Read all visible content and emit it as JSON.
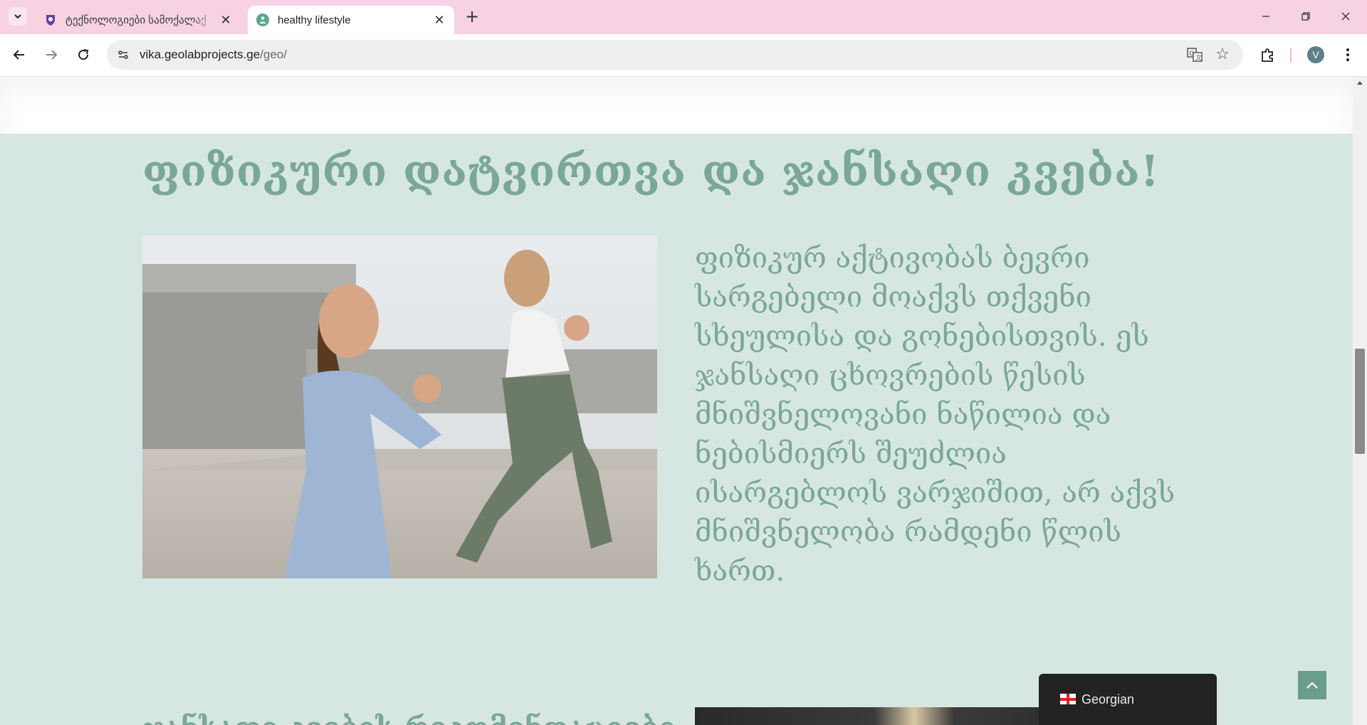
{
  "browser": {
    "tabs": [
      {
        "title": "ტექნოლოგიები სამოქალაქ",
        "active": false
      },
      {
        "title": "healthy lifestyle",
        "active": true
      }
    ],
    "url": {
      "host": "vika.geolabprojects.ge",
      "path": "/geo/"
    },
    "profile_initial": "V"
  },
  "page": {
    "section_title": "ფიზიკური დატვირთვა და ჯანსაღი კვება!",
    "body_lines": [
      "ფიზიკურ აქტივობას ბევრი",
      "სარგებელი მოაქვს თქვენი",
      "სხეულისა და გონებისთვის. ეს",
      "ჯანსაღი ცხოვრების წესის",
      "მნიშვნელოვანი ნაწილია და",
      "ნებისმიერს შეუძლია",
      "ისარგებლოს ვარჯიშით, არ აქვს",
      "მნიშვნელობა რამდენი წლის",
      "ხართ."
    ],
    "next_section_title_partial": "ჯანსაღი კვების რეკომენდაციები",
    "language_switcher": {
      "label": "Georgian",
      "flag": "georgia-flag"
    },
    "colors": {
      "accent": "#7aa797",
      "content_bg": "#d6e7e3",
      "tab_strip": "#f6d2e2",
      "back_to_top": "#6a9e8a"
    }
  },
  "scrollbar": {
    "position_fraction": 0.42
  }
}
